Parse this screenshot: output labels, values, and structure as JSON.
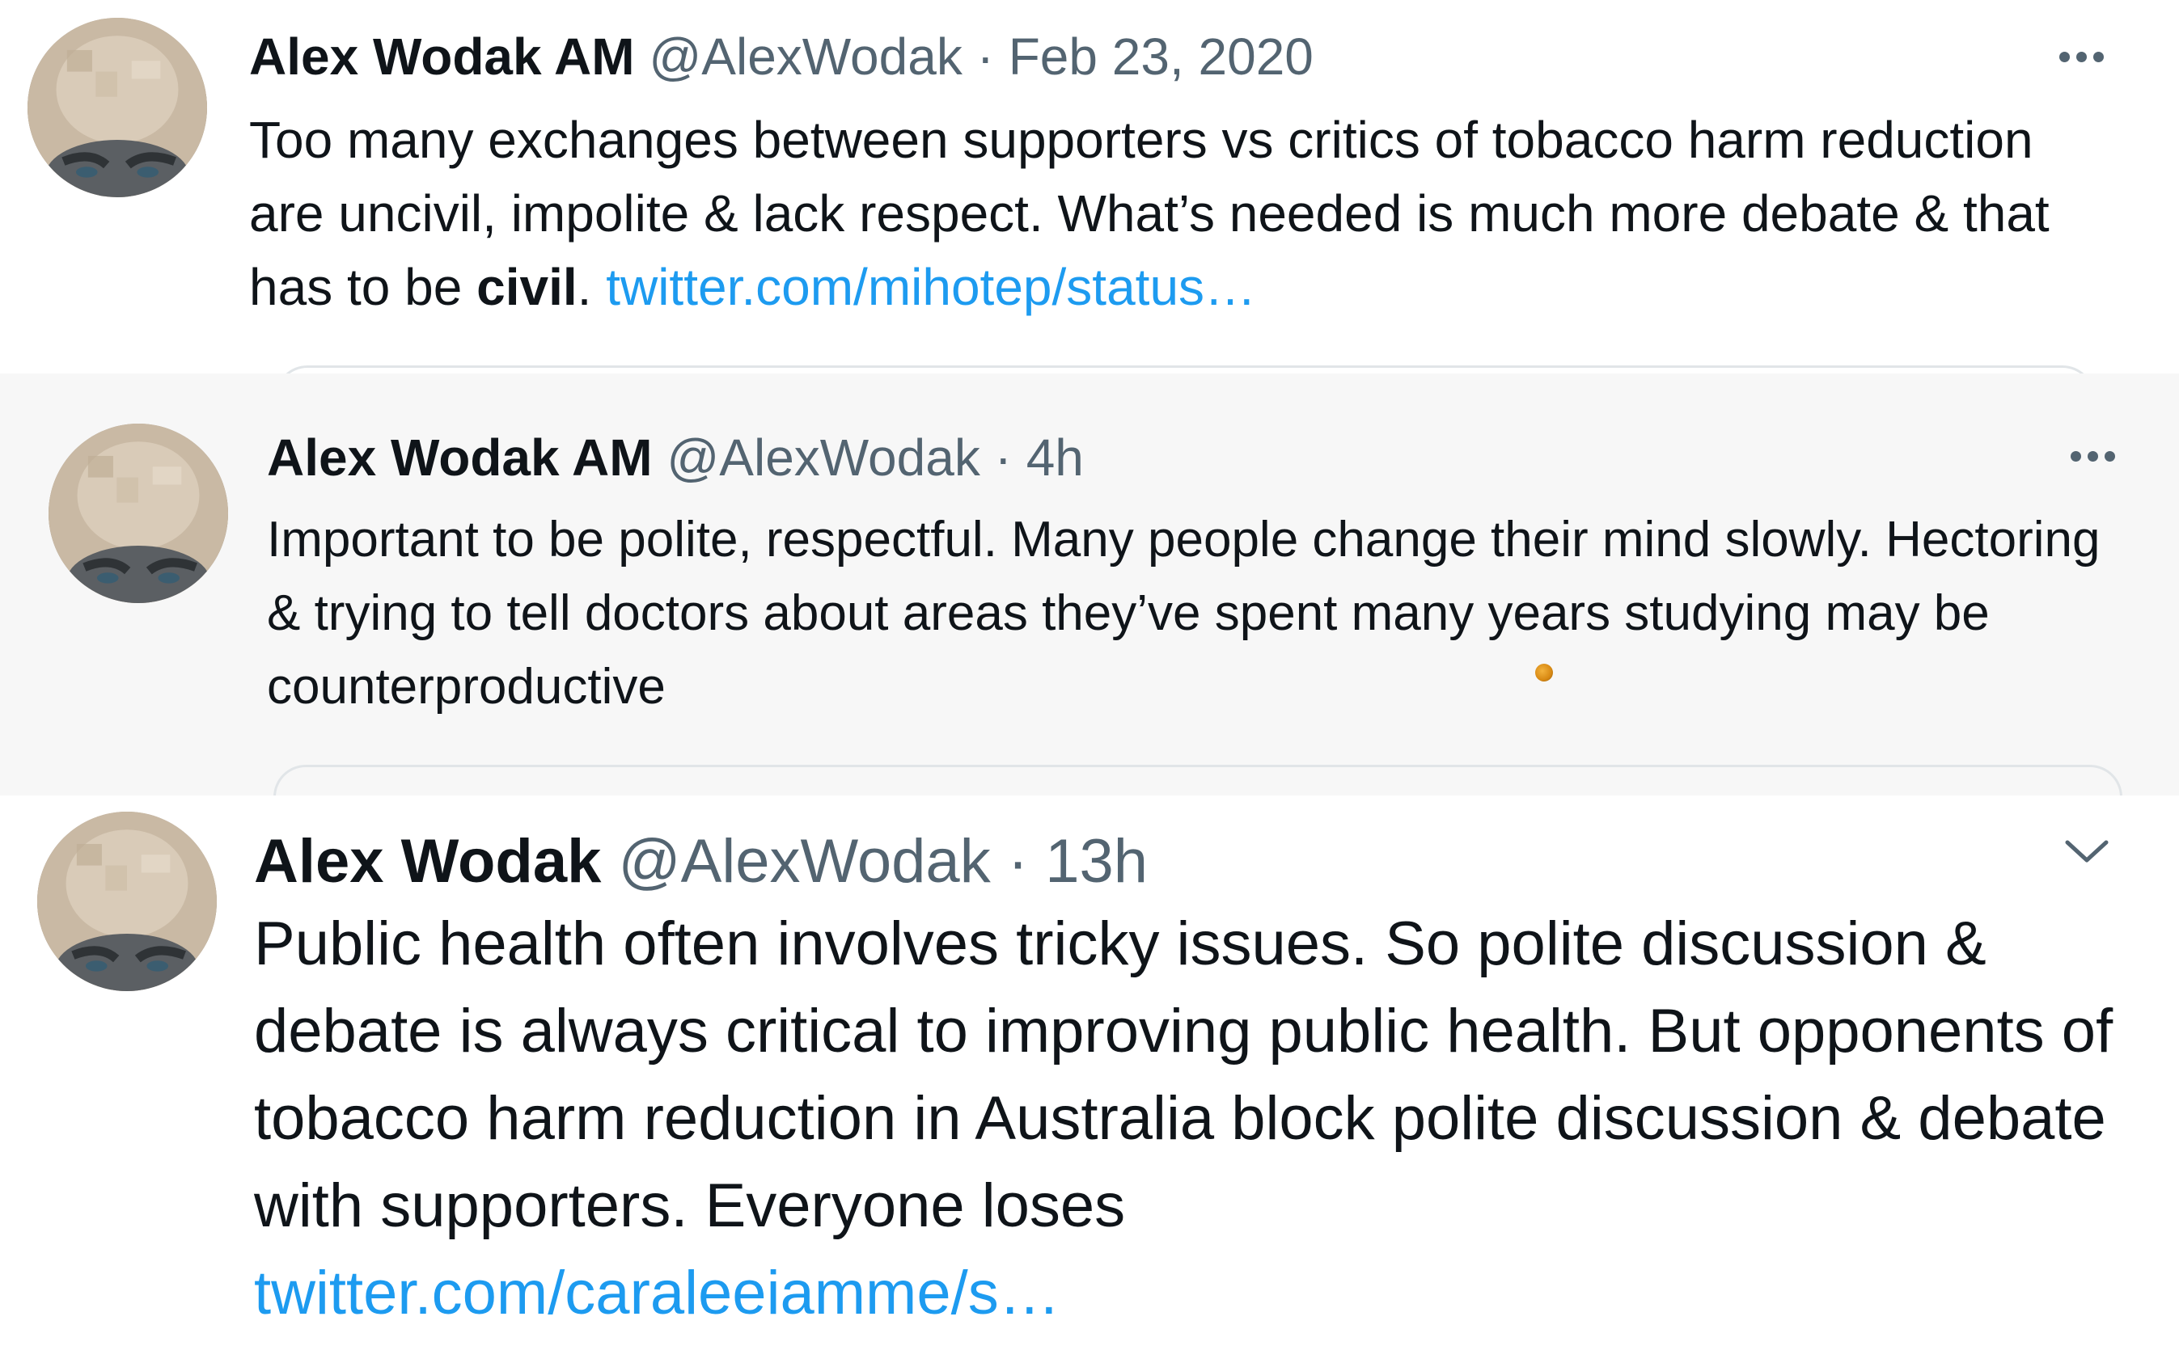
{
  "tweets": [
    {
      "name": "Alex Wodak AM",
      "handle": "@AlexWodak",
      "separator": "·",
      "time": "Feb 23, 2020",
      "text_before": "Too many exchanges between supporters vs critics of tobacco harm reduction are uncivil, impolite & lack respect. What’s needed is much more debate & that has to be ",
      "text_bold": "civil",
      "text_after": ". ",
      "link": "twitter.com/mihotep/status…",
      "menu_icon": "more-horizontal-icon",
      "avatar_icon": "profile-photo"
    },
    {
      "name": "Alex Wodak AM",
      "handle": "@AlexWodak",
      "separator": "·",
      "time": "4h",
      "text": "Important to be polite, respectful. Many people change their mind slowly. Hectoring & trying to tell doctors about areas they’ve spent many years studying may be counterproductive",
      "menu_icon": "more-horizontal-icon",
      "avatar_icon": "profile-photo"
    },
    {
      "name": "Alex Wodak",
      "handle": "@AlexWodak",
      "separator": "·",
      "time": "13h",
      "text": "Public health often involves tricky issues. So polite discussion & debate is always critical to improving public health. But opponents of tobacco harm reduction in Australia block polite discussion & debate with supporters. Everyone loses",
      "link": "twitter.com/caraleeiamme/s…",
      "menu_icon": "chevron-down-icon",
      "avatar_icon": "profile-photo"
    }
  ],
  "colors": {
    "text": "#0f1419",
    "secondary": "#536471",
    "link": "#1d9bf0",
    "band_background": "#f7f7f7"
  }
}
